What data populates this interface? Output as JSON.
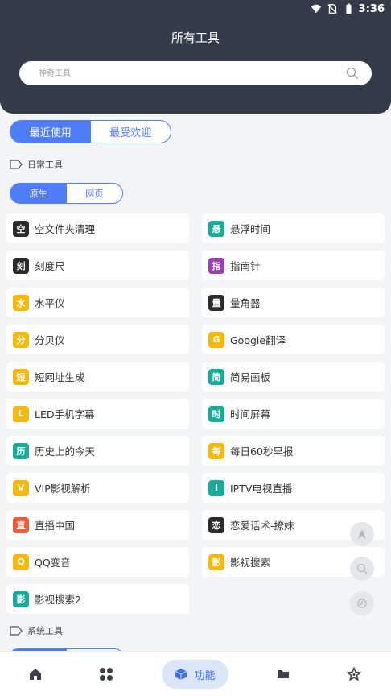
{
  "status": {
    "time": "3:36"
  },
  "header": {
    "title": "所有工具"
  },
  "search": {
    "placeholder": "神奇工具"
  },
  "tabs_main": [
    {
      "label": "最近使用",
      "active": true
    },
    {
      "label": "最受欢迎",
      "active": false
    }
  ],
  "section_daily": {
    "label": "日常工具"
  },
  "tabs_sub": [
    {
      "label": "原生",
      "active": true
    },
    {
      "label": "网页",
      "active": false
    }
  ],
  "tools": [
    {
      "badge": "空",
      "color": "#2b2b2b",
      "name": "空文件夹清理"
    },
    {
      "badge": "悬",
      "color": "#1aaa9a",
      "name": "悬浮时间"
    },
    {
      "badge": "刻",
      "color": "#2b2b2b",
      "name": "刻度尺"
    },
    {
      "badge": "指",
      "color": "#9b3fb5",
      "name": "指南针"
    },
    {
      "badge": "水",
      "color": "#f6b80b",
      "name": "水平仪"
    },
    {
      "badge": "量",
      "color": "#2b2b2b",
      "name": "量角器"
    },
    {
      "badge": "分",
      "color": "#f6b80b",
      "name": "分贝仪"
    },
    {
      "badge": "G",
      "color": "#f6b80b",
      "name": "Google翻译"
    },
    {
      "badge": "短",
      "color": "#f6b80b",
      "name": "短网址生成"
    },
    {
      "badge": "简",
      "color": "#1aaa9a",
      "name": "简易画板"
    },
    {
      "badge": "L",
      "color": "#f6b80b",
      "name": "LED手机字幕"
    },
    {
      "badge": "时",
      "color": "#1aaa9a",
      "name": "时间屏幕"
    },
    {
      "badge": "历",
      "color": "#1aaa9a",
      "name": "历史上的今天"
    },
    {
      "badge": "每",
      "color": "#f6b80b",
      "name": "每日60秒早报"
    },
    {
      "badge": "V",
      "color": "#f6b80b",
      "name": "VIP影视解析"
    },
    {
      "badge": "I",
      "color": "#1aaa9a",
      "name": "IPTV电视直播"
    },
    {
      "badge": "直",
      "color": "#ef5a3a",
      "name": "直播中国"
    },
    {
      "badge": "恋",
      "color": "#2b2b2b",
      "name": "恋爱话术-撩妹"
    },
    {
      "badge": "Q",
      "color": "#f6b80b",
      "name": "QQ变音"
    },
    {
      "badge": "影",
      "color": "#f6b80b",
      "name": "影视搜索"
    },
    {
      "badge": "影",
      "color": "#1aaa9a",
      "name": "影视搜索2"
    }
  ],
  "section_system": {
    "label": "系统工具"
  },
  "nav": {
    "items": [
      {
        "icon": "home-icon"
      },
      {
        "icon": "apps-icon"
      },
      {
        "icon": "cube-icon",
        "label": "功能",
        "active": true
      },
      {
        "icon": "folder-icon"
      },
      {
        "icon": "star-icon"
      }
    ]
  },
  "colors": {
    "header": "#343b48",
    "accent": "#4f7cf7",
    "nav_active_bg": "#dce6fb"
  }
}
